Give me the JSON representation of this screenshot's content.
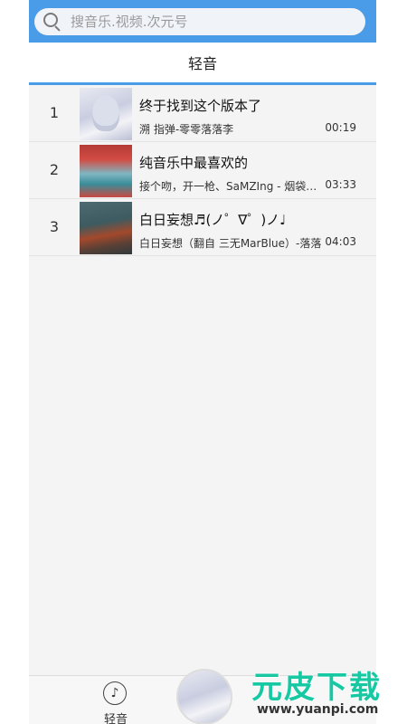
{
  "search": {
    "placeholder": "搜音乐.视频.次元号",
    "icon": "search-icon"
  },
  "header": {
    "title": "轻音",
    "accent_color": "#4a9be8"
  },
  "songs": [
    {
      "index": "1",
      "title": "终于找到这个版本了",
      "subtitle": "溯 指弹-零零落落李",
      "duration": "00:19"
    },
    {
      "index": "2",
      "title": "纯音乐中最喜欢的",
      "subtitle": "接个吻，开一枪、SaMZIng - 烟袋斜街",
      "duration": "03:33"
    },
    {
      "index": "3",
      "title": "白日妄想♬(ノ゜∇゜)ノ♩",
      "subtitle": "白日妄想（翻自 三无MarBlue）-落落",
      "duration": "04:03"
    }
  ],
  "bottom_nav": {
    "tab_label": "轻音",
    "tab_icon": "music-note-icon"
  },
  "watermark": {
    "main": "元皮下载",
    "sub": "www.yuanpi.com",
    "color": "#16c9a3"
  }
}
